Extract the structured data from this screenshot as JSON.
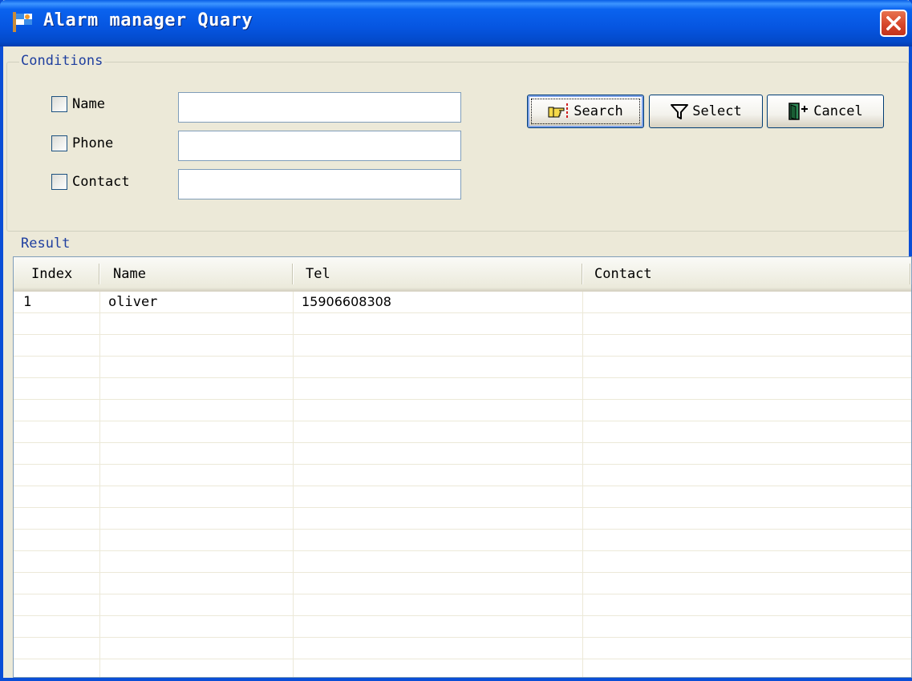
{
  "window": {
    "title": "Alarm manager Quary",
    "icon": "app-flag-icon"
  },
  "conditions": {
    "legend": "Conditions",
    "fields": [
      {
        "label": "Name",
        "value": "",
        "checked": false
      },
      {
        "label": "Phone",
        "value": "",
        "checked": false
      },
      {
        "label": "Contact",
        "value": "",
        "checked": false
      }
    ]
  },
  "buttons": {
    "search": {
      "label": "Search",
      "icon": "pointing-hand-icon"
    },
    "select": {
      "label": "Select",
      "icon": "funnel-icon"
    },
    "cancel": {
      "label": "Cancel",
      "icon": "exit-door-icon"
    }
  },
  "result": {
    "legend": "Result",
    "columns": [
      "Index",
      "Name",
      "Tel",
      "Contact"
    ],
    "rows": [
      [
        "1",
        "oliver",
        "15906608308",
        ""
      ]
    ]
  }
}
